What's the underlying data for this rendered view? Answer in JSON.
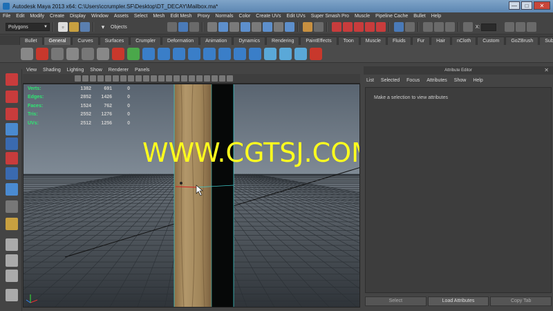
{
  "window": {
    "title": "Autodesk Maya 2013 x64: C:\\Users\\ccrumpler.SF\\Desktop\\DT_DECAY\\Mailbox.ma*",
    "minimize": "—",
    "maximize": "□",
    "close": "✕"
  },
  "menubar": [
    "File",
    "Edit",
    "Modify",
    "Create",
    "Display",
    "Window",
    "Assets",
    "Select",
    "Mesh",
    "Edit Mesh",
    "Proxy",
    "Normals",
    "Color",
    "Create UVs",
    "Edit UVs",
    "Super Smash Pro",
    "Muscle",
    "Pipeline Cache",
    "Bullet",
    "Help"
  ],
  "statusline": {
    "mode": "Polygons",
    "objects_label": "Objects",
    "x_label": "X:"
  },
  "shelf_tabs": [
    "Bullet",
    "General",
    "Curves",
    "Surfaces",
    "Crumpler",
    "Deformation",
    "Animation",
    "Dynamics",
    "Rendering",
    "PaintEffects",
    "Toon",
    "Muscle",
    "Fluids",
    "Fur",
    "Hair",
    "nCloth",
    "Custom",
    "GoZBrush",
    "Subdivs"
  ],
  "shelf_active": "General",
  "viewport_menu": [
    "View",
    "Shading",
    "Lighting",
    "Show",
    "Renderer",
    "Panels"
  ],
  "hud": {
    "rows": [
      {
        "label": "Verts:",
        "v1": "1382",
        "v2": "691",
        "v3": "0"
      },
      {
        "label": "Edges:",
        "v1": "2852",
        "v2": "1426",
        "v3": "0"
      },
      {
        "label": "Faces:",
        "v1": "1524",
        "v2": "762",
        "v3": "0"
      },
      {
        "label": "Tris:",
        "v1": "2552",
        "v2": "1276",
        "v3": "0"
      },
      {
        "label": "UVs:",
        "v1": "2512",
        "v2": "1256",
        "v3": "0"
      }
    ]
  },
  "watermark": "WWW.CGTSJ.COM",
  "attribute_editor": {
    "title": "Attribute Editor",
    "menu": [
      "List",
      "Selected",
      "Focus",
      "Attributes",
      "Show",
      "Help"
    ],
    "message": "Make a selection to view attributes",
    "buttons": [
      "Select",
      "Load Attributes",
      "Copy Tab"
    ]
  },
  "colors": {
    "hud_label": "#2ee872",
    "watermark": "#ffff1e",
    "wood": "#a1865a",
    "grid_bg_top": "#5e6873"
  }
}
